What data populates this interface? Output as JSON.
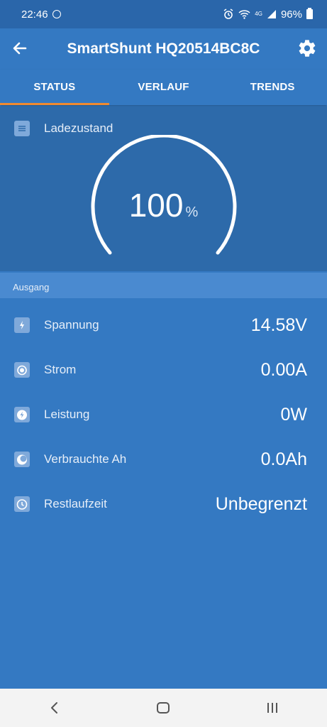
{
  "status_bar": {
    "time": "22:46",
    "network": "4G",
    "battery": "96%"
  },
  "app": {
    "title": "SmartShunt HQ20514BC8C"
  },
  "tabs": [
    {
      "label": "STATUS",
      "active": true
    },
    {
      "label": "VERLAUF",
      "active": false
    },
    {
      "label": "TRENDS",
      "active": false
    }
  ],
  "soc": {
    "label": "Ladezustand",
    "value": "100",
    "unit": "%",
    "fraction": 1.0
  },
  "section": {
    "title": "Ausgang"
  },
  "rows": [
    {
      "label": "Spannung",
      "value": "14.58V",
      "icon": "bolt-icon"
    },
    {
      "label": "Strom",
      "value": "0.00A",
      "icon": "circle-icon"
    },
    {
      "label": "Leistung",
      "value": "0W",
      "icon": "lightning-icon"
    },
    {
      "label": "Verbrauchte Ah",
      "value": "0.0Ah",
      "icon": "moon-icon"
    },
    {
      "label": "Restlaufzeit",
      "value": "Unbegrenzt",
      "icon": "clock-icon"
    }
  ],
  "colors": {
    "primary": "#3479c2",
    "dark": "#2d6aaa",
    "accent": "#f08a30",
    "section": "#4a8ad0"
  }
}
